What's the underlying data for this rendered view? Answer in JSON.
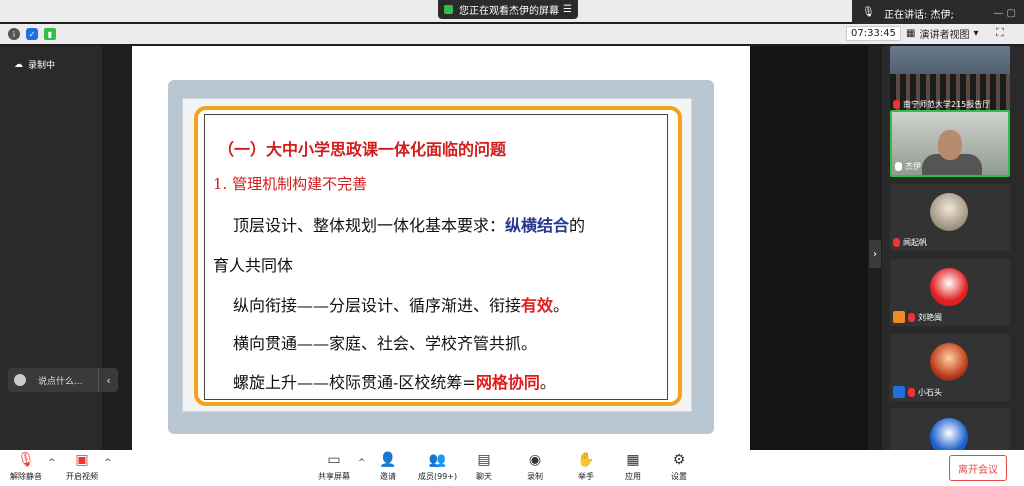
{
  "banner": {
    "viewing": "您正在观看杰伊的屏幕",
    "speaking_label": "正在讲话: 杰伊;"
  },
  "status": {
    "timer": "07:33:45",
    "view_mode": "演讲者视图"
  },
  "left": {
    "recording": "录制中",
    "chat_placeholder": "说点什么..."
  },
  "slide": {
    "title": "（一）大中小学思政课一体化面临的问题",
    "subtitle": "1.   管理机制构建不完善",
    "line1a": "顶层设计、整体规划一体化基本要求：",
    "line1b": "纵横结合",
    "line1c": "的",
    "line2": "育人共同体",
    "line3a": "纵向衔接——分层设计、循序渐进、衔接",
    "line3b": "有效",
    "line3c": "。",
    "line4": "横向贯通——家庭、社会、学校齐管共抓。",
    "line5a": "螺旋上升——校际贯通-区校统筹=",
    "line5b": "网格协同",
    "line5c": "。"
  },
  "participants": [
    {
      "name": "南宁师范大学215报告厅"
    },
    {
      "name": "杰伊"
    },
    {
      "name": "闻起帆"
    },
    {
      "name": "刘艳闽"
    },
    {
      "name": "小石头"
    }
  ],
  "toolbar": {
    "unmute": "解除静音",
    "start_video": "开启视频",
    "share": "共享屏幕",
    "invite": "邀请",
    "members": "成员(99+)",
    "chat": "聊天",
    "record": "录制",
    "raise_hand": "举手",
    "apps": "应用",
    "settings": "设置",
    "end": "离开会议"
  },
  "colors": {
    "accent_red": "#e31a1a",
    "accent_blue": "#26368f",
    "slide_border": "#f4a21b",
    "speaking_green": "#2fbf4a"
  }
}
